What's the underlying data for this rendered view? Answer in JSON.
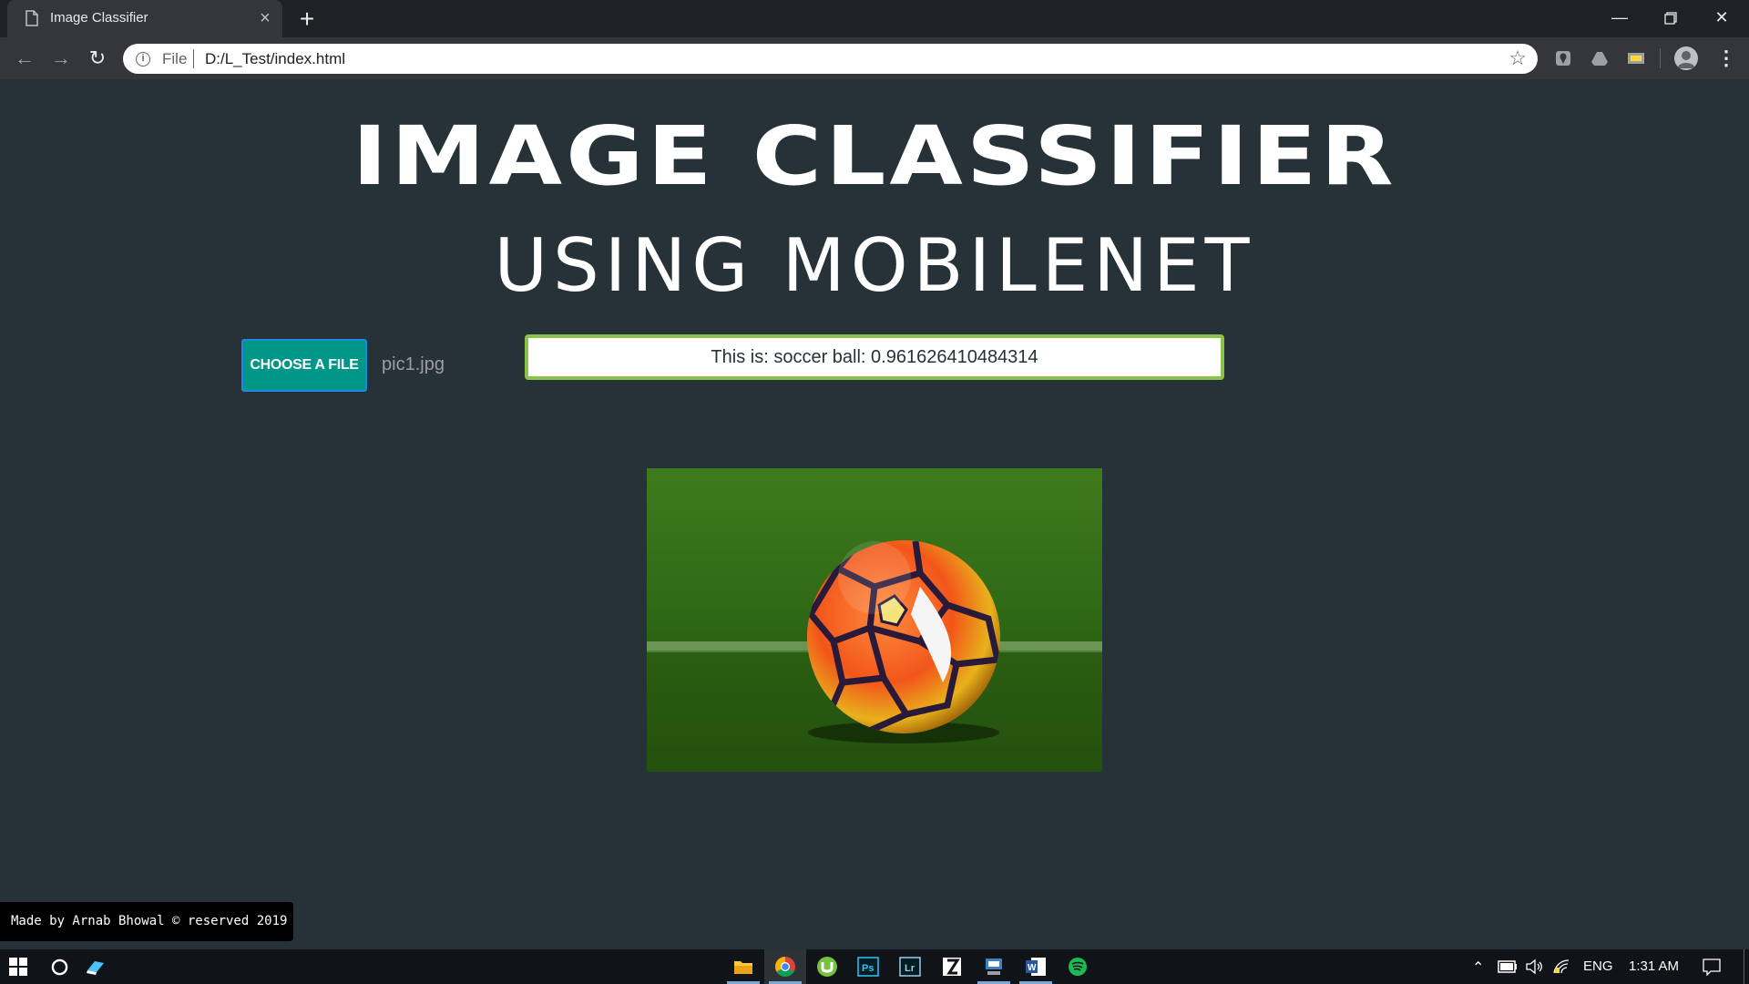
{
  "browser": {
    "tab_title": "Image Classifier",
    "omnibox": {
      "scheme": "File",
      "url": "D:/L_Test/index.html"
    }
  },
  "page": {
    "title": "IMAGE CLASSIFIER",
    "subtitle": "USING MOBILENET",
    "file_button_label": "CHOOSE A FILE",
    "file_name": "pic1.jpg",
    "result_text": "This is: soccer ball: 0.961626410484314",
    "footer": "Made by Arnab Bhowal © reserved 2019"
  },
  "taskbar": {
    "language": "ENG",
    "time": "1:31 AM",
    "pinned_apps": [
      "file-explorer",
      "chrome",
      "utorrent",
      "photoshop",
      "lightroom",
      "filezilla",
      "network",
      "word",
      "spotify"
    ]
  },
  "colors": {
    "page_background": "#263238",
    "button": "#009688",
    "result_border": "#8bc34a"
  }
}
